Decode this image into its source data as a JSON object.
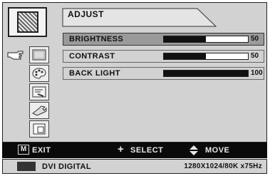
{
  "menu": {
    "title": "ADJUST",
    "items": [
      {
        "label": "BRIGHTNESS",
        "value": "50",
        "level": 0.5,
        "selected": true
      },
      {
        "label": "CONTRAST",
        "value": "50",
        "level": 0.5,
        "selected": false
      },
      {
        "label": "BACK LIGHT",
        "value": "100",
        "level": 1.0,
        "selected": false
      }
    ]
  },
  "sidebar": {
    "icons": [
      "adjust-icon",
      "picture-icon",
      "color-palette-icon",
      "tools-icon",
      "wrench-icon",
      "window-icon"
    ],
    "pointer_icon": "pointing-hand-icon"
  },
  "hints": {
    "exit_key": "M",
    "exit": "EXIT",
    "select": "SELECT",
    "move": "MOVE"
  },
  "status": {
    "input": "DVI DIGITAL",
    "mode": "1280X1024/80K x75Hz"
  },
  "colors": {
    "panel": "#d2d2d2",
    "selected_row": "#9a9a9a",
    "hint_bar": "#0a0a0a",
    "bar_fill": "#111111"
  }
}
